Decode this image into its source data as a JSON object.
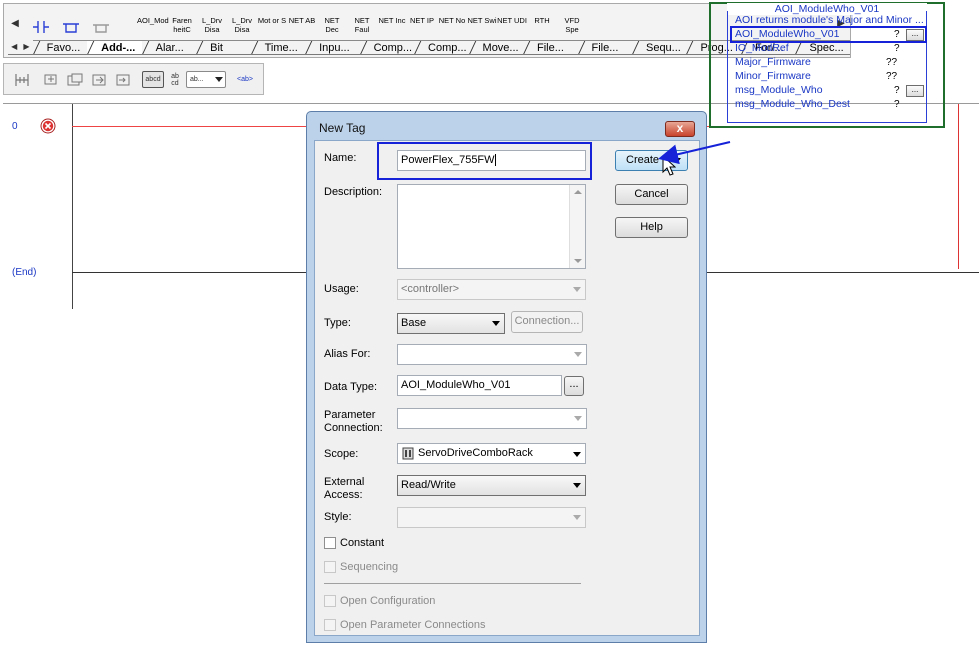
{
  "palette": {
    "instructions": [
      "AOI_Mod",
      "Faren heitC",
      "L_Drv Disa",
      "L_Drv Disa",
      "Mot or S",
      "NET AB",
      "NET Dec",
      "NET Faul",
      "NET Inc",
      "NET IP",
      "NET No",
      "NET Swi",
      "NET UDI",
      "RTH",
      "VFD Spe"
    ],
    "tabs": [
      "Favo...",
      "Add-...",
      "Alar...",
      "Bit",
      "Time...",
      "Inpu...",
      "Comp...",
      "Comp...",
      "Move...",
      "File...",
      "File...",
      "Sequ...",
      "Prog...",
      "For/...",
      "Spec..."
    ],
    "active_tab": "Add-..."
  },
  "toolbar2": {
    "abcd": "abcd",
    "abcd2": "ab cd",
    "abdots": "ab...",
    "ab_tag": "<ab>"
  },
  "ladder": {
    "rung_number": "0",
    "end_label": "(End)",
    "aoi": {
      "title": "AOI_ModuleWho_V01",
      "description": "AOI returns module's Major and Minor ...",
      "rows": [
        {
          "name": "AOI_ModuleWho_V01",
          "value": "?",
          "has_browse": true
        },
        {
          "name": "IO_ModRef",
          "value": "?",
          "has_browse": false
        },
        {
          "name": "Major_Firmware",
          "value": "??",
          "has_browse": false
        },
        {
          "name": "Minor_Firmware",
          "value": "??",
          "has_browse": false
        },
        {
          "name": "msg_Module_Who",
          "value": "?",
          "has_browse": true
        },
        {
          "name": "msg_Module_Who_Dest",
          "value": "?",
          "has_browse": false
        }
      ],
      "browse_label": "..."
    }
  },
  "dialog": {
    "title": "New Tag",
    "close": "x",
    "name_label": "Name:",
    "name_value": "PowerFlex_755FW",
    "description_label": "Description:",
    "usage_label": "Usage:",
    "usage_value": "<controller>",
    "type_label": "Type:",
    "type_value": "Base",
    "connection_button": "Connection...",
    "alias_label": "Alias For:",
    "alias_value": "",
    "datatype_label": "Data Type:",
    "datatype_value": "AOI_ModuleWho_V01",
    "datatype_browse": "...",
    "param_label_1": "Parameter",
    "param_label_2": "Connection:",
    "scope_label": "Scope:",
    "scope_value": "ServoDriveComboRack",
    "ext_label_1": "External",
    "ext_label_2": "Access:",
    "ext_value": "Read/Write",
    "style_label": "Style:",
    "constant_label": "Constant",
    "sequencing_label": "Sequencing",
    "open_config_label": "Open Configuration",
    "open_param_label": "Open Parameter Connections",
    "create_button": "Create",
    "cancel_button": "Cancel",
    "help_button": "Help"
  },
  "colors": {
    "highlight": "#1522d8",
    "aoi_border": "#1f6e2b",
    "rung_red": "#e44444",
    "ladder_text_blue": "#1a37c4"
  }
}
